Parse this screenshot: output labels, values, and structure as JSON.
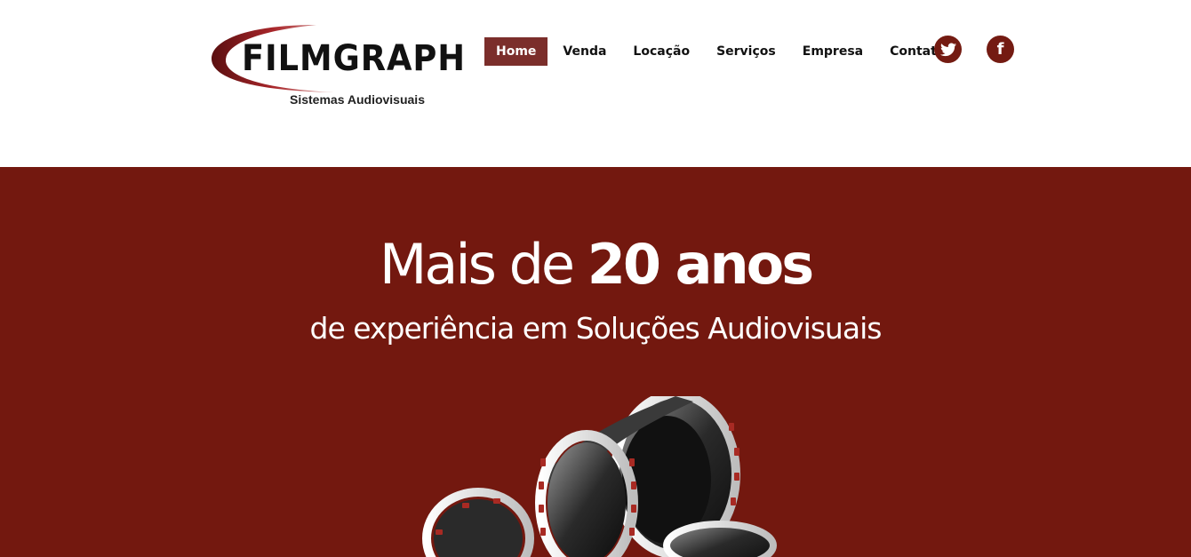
{
  "logo": {
    "wordmark": "FILMGRAPH",
    "tagline": "Sistemas Audiovisuais"
  },
  "nav": {
    "items": [
      {
        "label": "Home",
        "active": true
      },
      {
        "label": "Venda",
        "active": false
      },
      {
        "label": "Locação",
        "active": false
      },
      {
        "label": "Serviços",
        "active": false
      },
      {
        "label": "Empresa",
        "active": false
      },
      {
        "label": "Contato",
        "active": false
      }
    ]
  },
  "social": {
    "twitter_icon": "twitter-icon",
    "facebook_icon": "facebook-icon"
  },
  "hero": {
    "title_light": "Mais de ",
    "title_bold": "20 anos",
    "subtitle": "de experiência em Soluções Audiovisuais",
    "image": "film-reel-illustration"
  },
  "colors": {
    "brand": "#73180f",
    "nav_active": "#7b2e2b",
    "social_bg": "#741b12"
  }
}
